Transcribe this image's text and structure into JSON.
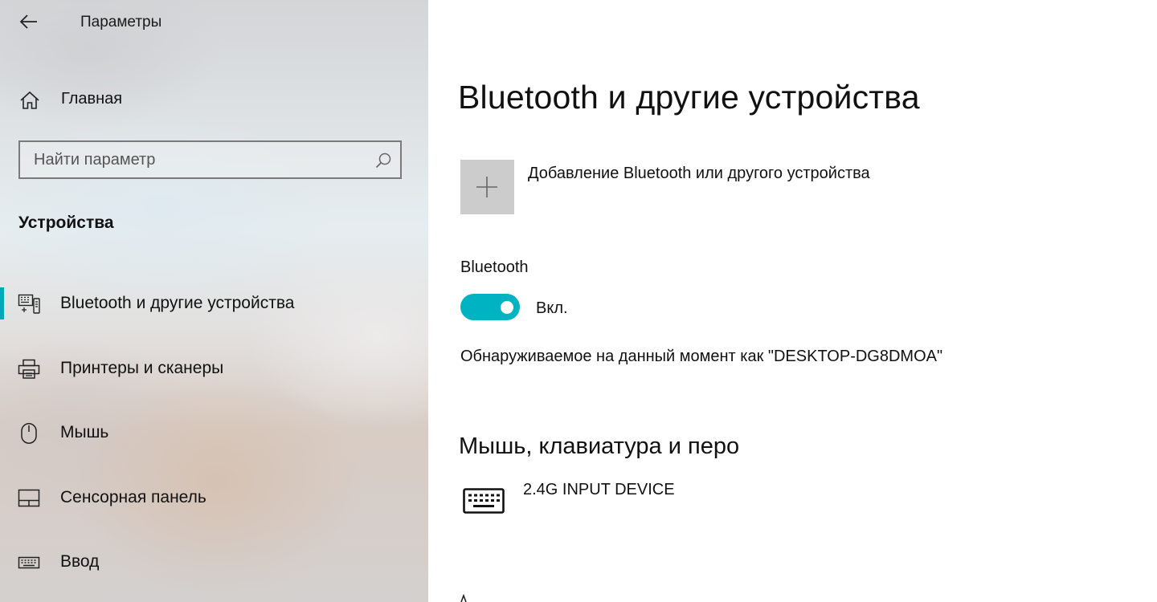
{
  "window": {
    "title": "Параметры",
    "back_icon": "arrow-left-icon"
  },
  "sidebar": {
    "home": {
      "label": "Главная",
      "icon": "home-icon"
    },
    "search": {
      "placeholder": "Найти параметр",
      "value": "",
      "icon": "search-icon"
    },
    "section_title": "Устройства",
    "items": [
      {
        "label": "Bluetooth и другие устройства",
        "icon": "bluetooth-devices-icon",
        "selected": true
      },
      {
        "label": "Принтеры и сканеры",
        "icon": "printer-icon",
        "selected": false
      },
      {
        "label": "Мышь",
        "icon": "mouse-icon",
        "selected": false
      },
      {
        "label": "Сенсорная панель",
        "icon": "touchpad-icon",
        "selected": false
      },
      {
        "label": "Ввод",
        "icon": "keyboard-icon",
        "selected": false
      }
    ]
  },
  "main": {
    "title": "Bluetooth и другие устройства",
    "add_device": {
      "label": "Добавление Bluetooth или другого устройства",
      "icon": "plus-icon"
    },
    "bluetooth": {
      "label": "Bluetooth",
      "state_label": "Вкл.",
      "on": true
    },
    "discoverable_text": "Обнаруживаемое на данный момент как \"DESKTOP-DG8DMOA\"",
    "section_heading": "Мышь, клавиатура и перо",
    "devices": [
      {
        "name": "2.4G INPUT DEVICE",
        "icon": "keyboard-icon"
      }
    ]
  },
  "colors": {
    "accent": "#00b3c3",
    "selection_indicator": "#00a9b7",
    "add_tile": "#cccccc"
  }
}
